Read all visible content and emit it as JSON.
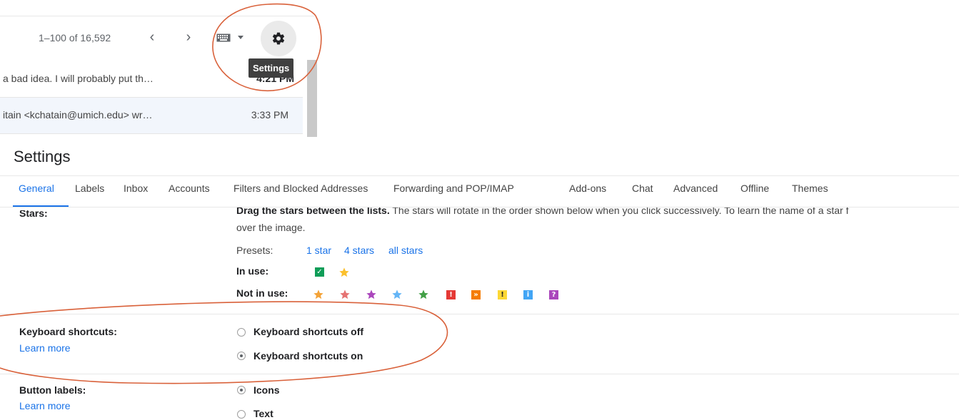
{
  "inbox": {
    "pager": "1–100 of 16,592",
    "prev_icon": "chevron-left",
    "next_icon": "chevron-right",
    "tooltip": "Settings",
    "rows": [
      {
        "snippet": "a bad idea. I will probably put th…",
        "time": "4:21 PM"
      },
      {
        "snippet": "itain <kchatain@umich.edu> wr…",
        "time": "3:33 PM"
      }
    ]
  },
  "settings": {
    "title": "Settings",
    "tabs": [
      "General",
      "Labels",
      "Inbox",
      "Accounts",
      "Filters and Blocked Addresses",
      "Forwarding and POP/IMAP",
      "Add-ons",
      "Chat",
      "Advanced",
      "Offline",
      "Themes"
    ],
    "stars": {
      "label": "Stars:",
      "desc_bold": "Drag the stars between the lists.",
      "desc_rest": "  The stars will rotate in the order shown below when you click successively. To learn the name of a star f",
      "desc_line2": "over the image.",
      "presets_label": "Presets:",
      "presets": [
        "1 star",
        "4 stars",
        "all stars"
      ],
      "in_use_label": "In use:",
      "not_in_use_label": "Not in use:",
      "not_in_use_marks": [
        "!",
        "»",
        "!",
        "i",
        "?"
      ]
    },
    "keyboard_shortcuts": {
      "label": "Keyboard shortcuts:",
      "learn_more": "Learn more",
      "off_label": "Keyboard shortcuts off",
      "on_label": "Keyboard shortcuts on",
      "selected": "on"
    },
    "button_labels": {
      "label": "Button labels:",
      "learn_more": "Learn more",
      "icons_label": "Icons",
      "text_label": "Text",
      "selected": "icons"
    }
  },
  "colors": {
    "accent": "#1a73e8",
    "annotation": "#d9613a",
    "tooltip_bg": "#404040"
  }
}
